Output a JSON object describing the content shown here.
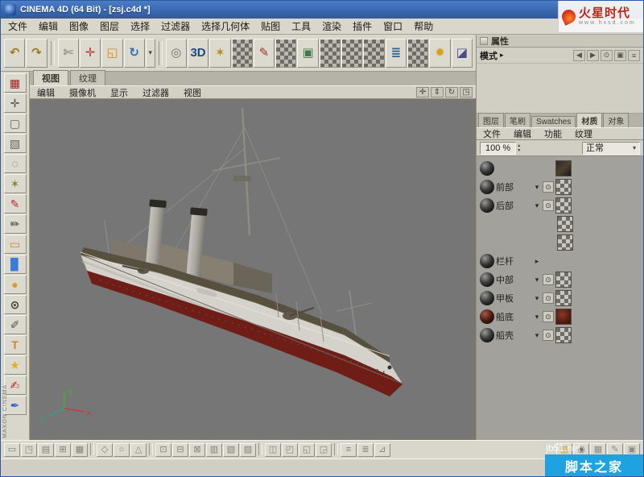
{
  "window": {
    "title": "CINEMA 4D (64 Bit) - [zsj.c4d *]",
    "side_logo": "MAXON CINEMA",
    "watermark_top": {
      "brand": "火星时代",
      "url": "www.hxsd.com"
    },
    "watermark_bottom": {
      "site": "jb51.net",
      "label": "脚本之家"
    }
  },
  "menubar": {
    "items": [
      "文件",
      "编辑",
      "图像",
      "图层",
      "选择",
      "过滤器",
      "选择几何体",
      "贴图",
      "工具",
      "渲染",
      "插件",
      "窗口",
      "帮助"
    ]
  },
  "toolbar": {
    "icons": [
      {
        "name": "undo-icon",
        "glyph": "↶",
        "color": "#9a7b20"
      },
      {
        "name": "redo-icon",
        "glyph": "↷",
        "color": "#9a7b20"
      },
      {
        "kind": "sep"
      },
      {
        "name": "knife-tool-icon",
        "glyph": "✄",
        "color": "#6b6b6b"
      },
      {
        "name": "move-tool-icon",
        "glyph": "✛",
        "color": "#b23b2e"
      },
      {
        "name": "scale-tool-icon",
        "glyph": "◱",
        "color": "#d88a1f"
      },
      {
        "name": "rotate-tool-icon",
        "glyph": "↻",
        "color": "#2d6fb0"
      },
      {
        "name": "tool-history-dropdown-icon",
        "glyph": "▾",
        "color": "#4a4a4a",
        "kind": "narrow"
      },
      {
        "kind": "sep"
      },
      {
        "name": "axis-mode-icon",
        "glyph": "◎",
        "color": "#6f6f6f"
      },
      {
        "name": "paint-3d-icon",
        "glyph": "3D",
        "color": "#184a85"
      },
      {
        "name": "paint-setup-wizard-icon",
        "glyph": "✶",
        "color": "#b8860b"
      },
      {
        "name": "projection-paint-icon",
        "kind": "checker"
      },
      {
        "name": "brush-preset-icon",
        "glyph": "✎",
        "color": "#a33327"
      },
      {
        "name": "texture-channel-icon",
        "kind": "checker"
      },
      {
        "name": "render-picture-icon",
        "glyph": "▣",
        "color": "#3f7a4f"
      },
      {
        "name": "uv-checker-1-icon",
        "kind": "checker"
      },
      {
        "name": "uv-checker-2-icon",
        "kind": "checker"
      },
      {
        "name": "uv-checker-3-icon",
        "kind": "checker"
      },
      {
        "name": "uv-graph-icon",
        "glyph": "≣",
        "color": "#35618f"
      },
      {
        "name": "uv-checker-4-icon",
        "kind": "checker"
      },
      {
        "name": "light-icon",
        "glyph": "✹",
        "color": "#d8a01f"
      },
      {
        "name": "chart-icon",
        "glyph": "◪",
        "color": "#4a4a88"
      }
    ]
  },
  "left_toolbar": {
    "icons": [
      {
        "name": "texture-paint-icon",
        "glyph": "▦",
        "color": "#b02020"
      },
      {
        "name": "move-canvas-icon",
        "glyph": "✛",
        "color": "#555555"
      },
      {
        "name": "crop-icon",
        "glyph": "▢",
        "color": "#666666"
      },
      {
        "name": "marquee-select-icon",
        "glyph": "▧",
        "color": "#666666"
      },
      {
        "name": "lasso-select-icon",
        "glyph": "◌",
        "color": "#666666"
      },
      {
        "name": "magic-wand-icon",
        "glyph": "✶",
        "color": "#7a8a3a"
      },
      {
        "name": "paint-brush-icon",
        "glyph": "✎",
        "color": "#b03030"
      },
      {
        "name": "pencil-icon",
        "glyph": "✏",
        "color": "#3a3a3a"
      },
      {
        "name": "eraser-icon",
        "glyph": "▭",
        "color": "#d8812a"
      },
      {
        "name": "fill-bucket-icon",
        "glyph": "▉",
        "color": "#3a7bd5"
      },
      {
        "name": "smudge-drop-icon",
        "glyph": "●",
        "color": "#e09a2a"
      },
      {
        "name": "magnify-icon",
        "glyph": "⊙",
        "color": "#333333"
      },
      {
        "name": "eyedropper-icon",
        "glyph": "✐",
        "color": "#555555"
      },
      {
        "name": "text-tool-icon",
        "glyph": "T",
        "color": "#d8812a"
      },
      {
        "name": "star-shape-icon",
        "glyph": "★",
        "color": "#e0b020"
      },
      {
        "name": "clone-brush-icon",
        "glyph": "✍",
        "color": "#b03030"
      },
      {
        "name": "airbrush-icon",
        "glyph": "✒",
        "color": "#2a5fd0"
      }
    ]
  },
  "viewport": {
    "tabs": [
      {
        "label": "视图",
        "state": "active"
      },
      {
        "label": "纹理"
      }
    ],
    "menu": [
      "编辑",
      "摄像机",
      "显示",
      "过滤器",
      "视图"
    ],
    "controls": [
      {
        "name": "pan-view-icon",
        "glyph": "✛"
      },
      {
        "name": "zoom-view-icon",
        "glyph": "⇕"
      },
      {
        "name": "rotate-view-icon",
        "glyph": "↻"
      },
      {
        "name": "maximize-view-icon",
        "glyph": "◳"
      }
    ],
    "axis": {
      "x": "x",
      "y": "y",
      "z": "z"
    }
  },
  "attributes": {
    "title": "属性",
    "mode_label": "模式",
    "mode_arrow": "▸",
    "icons": [
      {
        "name": "back-icon",
        "glyph": "◀"
      },
      {
        "name": "forward-icon",
        "glyph": "▶"
      },
      {
        "name": "search-icon",
        "glyph": "⊙"
      },
      {
        "name": "lock-icon",
        "glyph": "▣"
      },
      {
        "name": "panel-menu-icon",
        "glyph": "≡"
      }
    ]
  },
  "materials": {
    "tabs": [
      {
        "label": "图层"
      },
      {
        "label": "笔刷"
      },
      {
        "label": "Swatches"
      },
      {
        "label": "材质",
        "state": "active"
      },
      {
        "label": "对象"
      }
    ],
    "menu": [
      "文件",
      "编辑",
      "功能",
      "纹理"
    ],
    "zoom": "100 %",
    "zoom_up": "▴",
    "zoom_down": "▾",
    "blend": "正常",
    "blend_arrow": "▾",
    "rows": [
      {
        "kind": "header",
        "name": "",
        "thumb": "photo"
      },
      {
        "name": "前部",
        "arrow": "▾",
        "eye": "⊙",
        "thumb": "checker"
      },
      {
        "name": "后部",
        "arrow": "▾",
        "eye": "⊙",
        "thumb": "checker"
      },
      {
        "kind": "indent",
        "thumb": "checker"
      },
      {
        "kind": "indent",
        "thumb": "checker"
      },
      {
        "name": "栏杆",
        "arrow": "▸"
      },
      {
        "name": "中部",
        "arrow": "▾",
        "eye": "⊙",
        "thumb": "checker"
      },
      {
        "name": "甲板",
        "arrow": "▾",
        "eye": "⊙",
        "thumb": "checker"
      },
      {
        "name": "船底",
        "arrow": "▾",
        "eye": "⊙",
        "thumb": "red",
        "sphere": "darkred"
      },
      {
        "name": "船壳",
        "arrow": "▾",
        "eye": "⊙",
        "thumb": "checker"
      }
    ]
  },
  "bottom_toolbar": {
    "left_icons": [
      {
        "name": "snap-icon",
        "glyph": "▭"
      },
      {
        "name": "grid-toggle-icon",
        "glyph": "◳"
      },
      {
        "name": "layout-icon",
        "glyph": "▤"
      },
      {
        "name": "add-view-icon",
        "glyph": "⊞"
      },
      {
        "name": "texture-view-icon",
        "glyph": "▦"
      },
      {
        "kind": "sep"
      },
      {
        "name": "shape-icon",
        "glyph": "◇"
      },
      {
        "name": "circle-icon",
        "glyph": "○"
      },
      {
        "name": "triangle-icon",
        "glyph": "△"
      },
      {
        "kind": "sep"
      },
      {
        "name": "box-icon",
        "glyph": "⊡"
      },
      {
        "name": "minus-box-icon",
        "glyph": "⊟"
      },
      {
        "name": "cross-box-icon",
        "glyph": "⊠"
      },
      {
        "name": "rows-icon",
        "glyph": "▥"
      },
      {
        "name": "diag-icon",
        "glyph": "▧"
      },
      {
        "name": "hatch-icon",
        "glyph": "▨"
      },
      {
        "kind": "sep"
      },
      {
        "name": "split-view-icon",
        "glyph": "◫"
      },
      {
        "name": "quad-1-icon",
        "glyph": "◰"
      },
      {
        "name": "quad-2-icon",
        "glyph": "◱"
      },
      {
        "name": "quad-3-icon",
        "glyph": "◲"
      },
      {
        "kind": "sep"
      },
      {
        "name": "list-icon",
        "glyph": "≡"
      },
      {
        "name": "stack-icon",
        "glyph": "≣"
      },
      {
        "name": "wedge-icon",
        "glyph": "⊿"
      }
    ],
    "right_icons": [
      {
        "name": "folder-icon",
        "glyph": "▨",
        "color": "#c9a23a"
      },
      {
        "name": "material-ball-icon",
        "glyph": "◉",
        "color": "#777777"
      },
      {
        "name": "grid-icon",
        "glyph": "▦",
        "color": "#8a8a8a"
      },
      {
        "name": "paint-icon",
        "glyph": "✎",
        "color": "#8a8a8a"
      },
      {
        "name": "close-panel-icon",
        "glyph": "▣",
        "color": "#8a8a8a"
      }
    ]
  },
  "colors": {
    "accent-blue": "#1fa2e0",
    "viewport-bg": "#767676",
    "hull-red": "#701d18",
    "title-blue-1": "#4a7cc8",
    "title-blue-2": "#2e5a9e"
  }
}
